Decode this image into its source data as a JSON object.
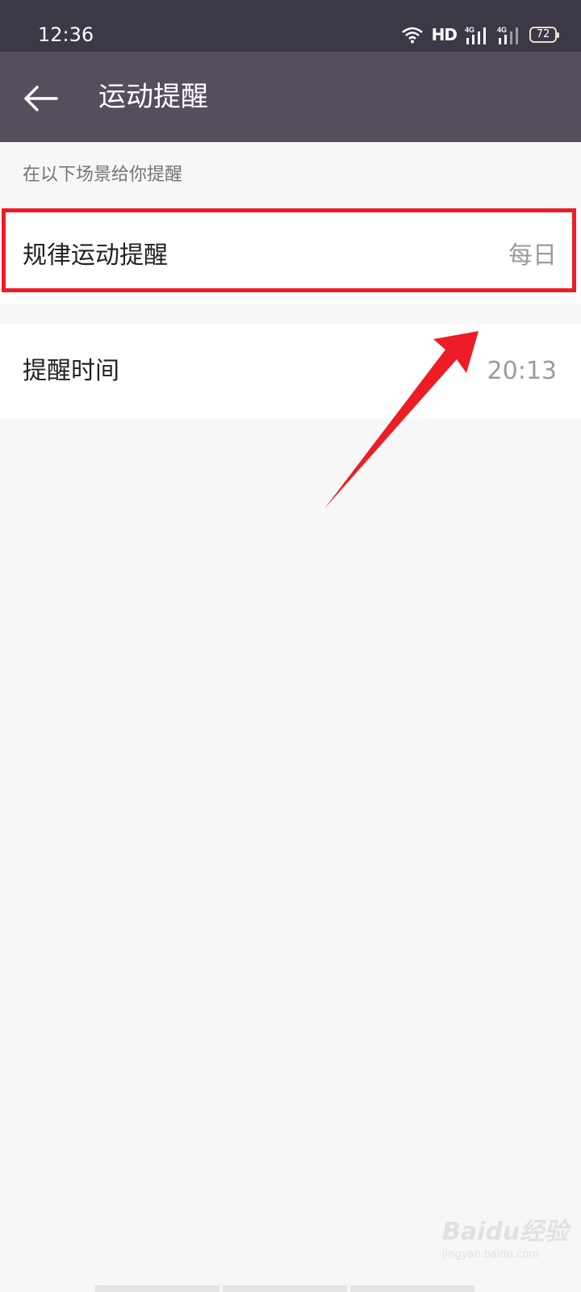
{
  "status_bar": {
    "time": "12:36",
    "network_label": "HD",
    "signal_1_label": "4G",
    "signal_2_label": "4G",
    "battery_level": "72"
  },
  "app_bar": {
    "back_icon": "arrow-left-icon",
    "title": "运动提醒"
  },
  "section": {
    "hint": "在以下场景给你提醒"
  },
  "settings": [
    {
      "label": "规律运动提醒",
      "value": "每日"
    },
    {
      "label": "提醒时间",
      "value": "20:13"
    }
  ],
  "watermark": {
    "logo": "Baidu经验",
    "url": "jingyan.baidu.com"
  },
  "colors": {
    "status_bar_bg": "#3d3846",
    "app_bar_bg": "#574e5d",
    "highlight": "#ee1c25",
    "page_bg": "#f7f7f7"
  }
}
